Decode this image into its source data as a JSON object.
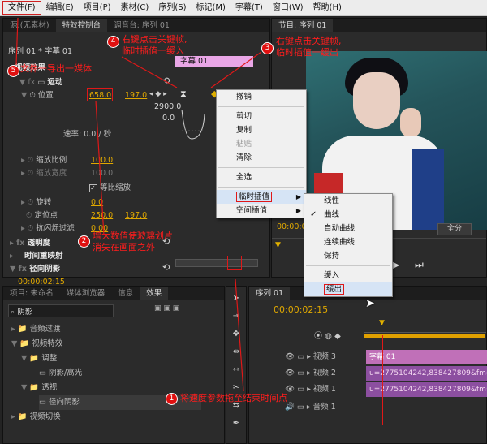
{
  "menubar": {
    "items": [
      "文件(F)",
      "编辑(E)",
      "项目(P)",
      "素材(C)",
      "序列(S)",
      "标记(M)",
      "字幕(T)",
      "窗口(W)",
      "帮助(H)"
    ]
  },
  "source_panel": {
    "tabs": [
      "源:(无素材)",
      "特效控制台",
      "调音台: 序列 01"
    ],
    "seq_label": "序列 01 * 字幕 01",
    "caption_clip": "字幕 01",
    "video_effects": "视频效果",
    "motion": "运动",
    "position": "位置",
    "position_x": "658.0",
    "position_y": "197.0",
    "graph_max": "2900.0",
    "graph_zero": "0.0",
    "velocity": "速率: 0.0 / 秒",
    "scale": "缩放比例",
    "scale_val": "100.0",
    "scale_width": "缩放宽度",
    "scale_width_val": "100.0",
    "uniform_scale": "等比缩放",
    "rotation": "旋转",
    "rotation_val": "0.0",
    "anchor": "定位点",
    "anchor_x": "250.0",
    "anchor_y": "197.0",
    "antiflicker": "抗闪烁过滤",
    "antiflicker_val": "0.00",
    "opacity": "透明度",
    "time_remap": "时间重映射",
    "radial_shadow": "径向阴影",
    "shadow_color": "阴影颜色",
    "timecode": "00:00:02:15"
  },
  "program_panel": {
    "title": "节目: 序列 01",
    "timecode": "00:00:02:15",
    "full": "全分"
  },
  "context_menu_1": {
    "items": [
      "撤销",
      "剪切",
      "复制",
      "粘贴",
      "清除",
      "全选",
      "临时插值",
      "空间插值"
    ]
  },
  "context_menu_2": {
    "items": [
      "线性",
      "曲线",
      "自动曲线",
      "连续曲线",
      "保持",
      "缓入",
      "缓出"
    ]
  },
  "project_panel": {
    "tabs": [
      "项目: 未命名",
      "媒体浏览器",
      "信息",
      "效果"
    ],
    "search": "阴影",
    "tree": [
      "音频过渡",
      "视频特效",
      "调整",
      "阴影/高光",
      "透视",
      "径向阴影",
      "视频切换"
    ]
  },
  "timeline": {
    "tab": "序列 01",
    "timecode": "00:00:02:15",
    "tracks": [
      "视频 3",
      "视频 2",
      "视频 1",
      "音频 1"
    ],
    "clips": [
      "字幕 01",
      "u=2775104242,838427809&fm=26",
      "u=2775104242,838427809&fm=26"
    ]
  },
  "annotations": {
    "a1": "将速度参数拖至结束时间点",
    "a2": "增大数值使玻璃划片",
    "a2b": "消失在画面之外",
    "a3": "右键点击关键帧,",
    "a3b": "临时插值一缓出",
    "a4": "右键点击关键帧,",
    "a4b": "临时插值一缓入",
    "a5": "文件一导出一媒体",
    "badges": [
      "1",
      "2",
      "3",
      "4",
      "5"
    ]
  },
  "colors": {
    "accent_blue": "#4aa0ff",
    "value_orange": "#e0a800",
    "annotation_red": "#ff1d1d",
    "caption_pink": "#e9a6e6"
  }
}
